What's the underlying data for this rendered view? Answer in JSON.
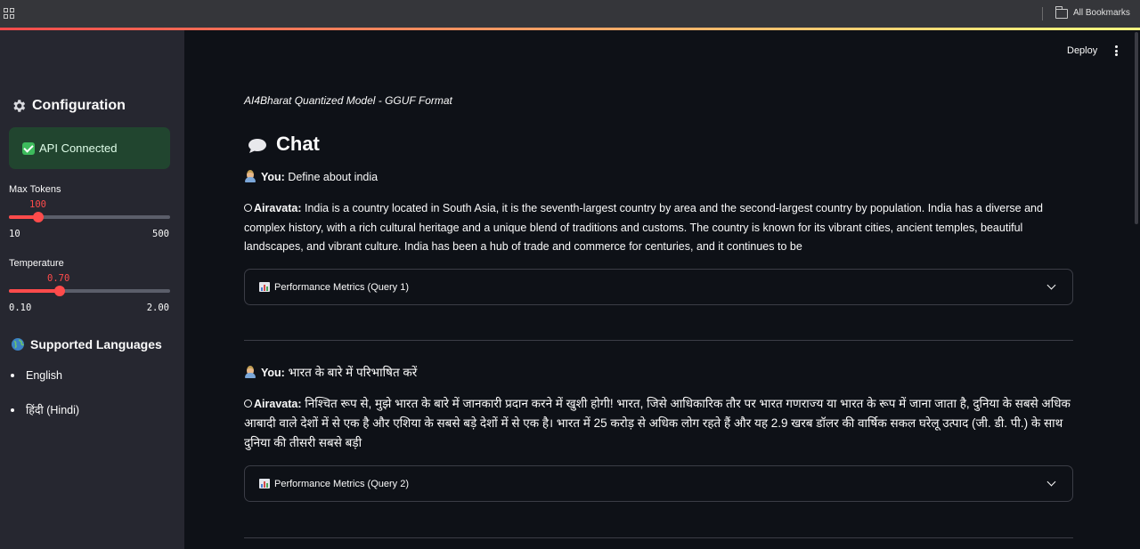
{
  "browser": {
    "bookmarks_label": "All Bookmarks"
  },
  "sidebar": {
    "config_title": "Configuration",
    "api_status": "API Connected",
    "max_tokens": {
      "label": "Max Tokens",
      "value": "100",
      "min": "10",
      "max": "500",
      "fraction": 0.184
    },
    "temperature": {
      "label": "Temperature",
      "value": "0.70",
      "min": "0.10",
      "max": "2.00",
      "fraction": 0.317
    },
    "languages_title": "Supported Languages",
    "languages": [
      "English",
      "हिंदी (Hindi)"
    ]
  },
  "header": {
    "deploy_label": "Deploy"
  },
  "main": {
    "subtitle": "AI4Bharat Quantized Model - GGUF Format",
    "chat_title": "Chat",
    "user_label": "You:",
    "bot_label": "Airavata:",
    "messages": [
      {
        "user": "Define about india",
        "bot": "India is a country located in South Asia, it is the seventh-largest country by area and the second-largest country by population. India has a diverse and complex history, with a rich cultural heritage and a unique blend of traditions and customs. The country is known for its vibrant cities, ancient temples, beautiful landscapes, and vibrant culture. India has been a hub of trade and commerce for centuries, and it continues to be",
        "metrics_label": "Performance Metrics (Query 1)"
      },
      {
        "user": "भारत के बारे में परिभाषित करें",
        "bot": "निश्चित रूप से, मुझे भारत के बारे में जानकारी प्रदान करने में खुशी होगी! भारत, जिसे आधिकारिक तौर पर भारत गणराज्य या भारत के रूप में जाना जाता है, दुनिया के सबसे अधिक आबादी वाले देशों में से एक है और एशिया के सबसे बड़े देशों में से एक है। भारत में 25 करोड़ से अधिक लोग रहते हैं और यह 2.9 खरब डॉलर की वार्षिक सकल घरेलू उत्पाद (जी. डी. पी.) के साथ दुनिया की तीसरी सबसे बड़ी",
        "metrics_label": "Performance Metrics (Query 2)"
      }
    ]
  },
  "colors": {
    "accent": "#ff4b4b",
    "background": "#0e1117",
    "sidebar": "#262730",
    "success_bg": "#21452f"
  }
}
